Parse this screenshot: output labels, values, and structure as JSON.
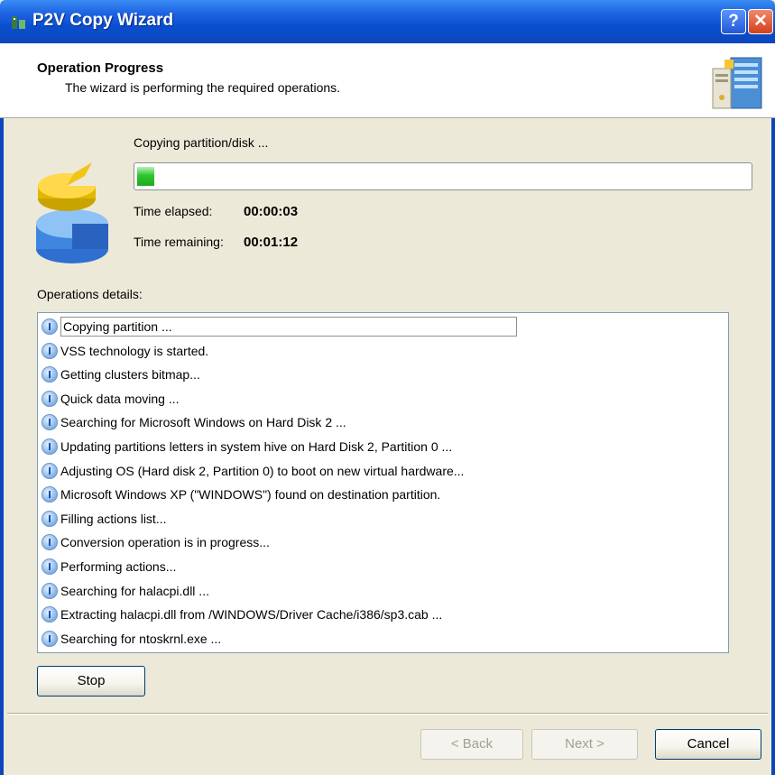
{
  "window": {
    "title": "P2V Copy Wizard",
    "help_label": "?",
    "close_label": "✕"
  },
  "header": {
    "title": "Operation Progress",
    "subtitle": "The wizard is performing the required operations."
  },
  "progress": {
    "status": "Copying partition/disk ...",
    "fraction": 0.02,
    "elapsed_label": "Time elapsed:",
    "elapsed_value": "00:00:03",
    "remaining_label": "Time remaining:",
    "remaining_value": "00:01:12"
  },
  "operations": {
    "label": "Operations details:",
    "items": [
      "Copying partition ...",
      "VSS technology is started.",
      "Getting clusters bitmap...",
      "Quick data moving ...",
      "Searching for Microsoft Windows on Hard Disk 2 ...",
      "Updating partitions letters in system hive on Hard Disk 2, Partition 0 ...",
      "Adjusting OS (Hard disk 2, Partition 0) to boot on new virtual hardware...",
      "Microsoft Windows XP (\"WINDOWS\") found on destination partition.",
      "Filling actions list...",
      "Conversion operation is in progress...",
      "Performing actions...",
      "Searching for halacpi.dll ...",
      "Extracting halacpi.dll from /WINDOWS/Driver Cache/i386/sp3.cab ...",
      "Searching for ntoskrnl.exe ..."
    ],
    "item_icon": "info-icon"
  },
  "buttons": {
    "stop": "Stop",
    "back": "< Back",
    "next": "Next >",
    "cancel": "Cancel"
  },
  "colors": {
    "titlebar": "#0b46bd",
    "progress_fill": "#2ec52e",
    "dialog_bg": "#ece9d8"
  }
}
